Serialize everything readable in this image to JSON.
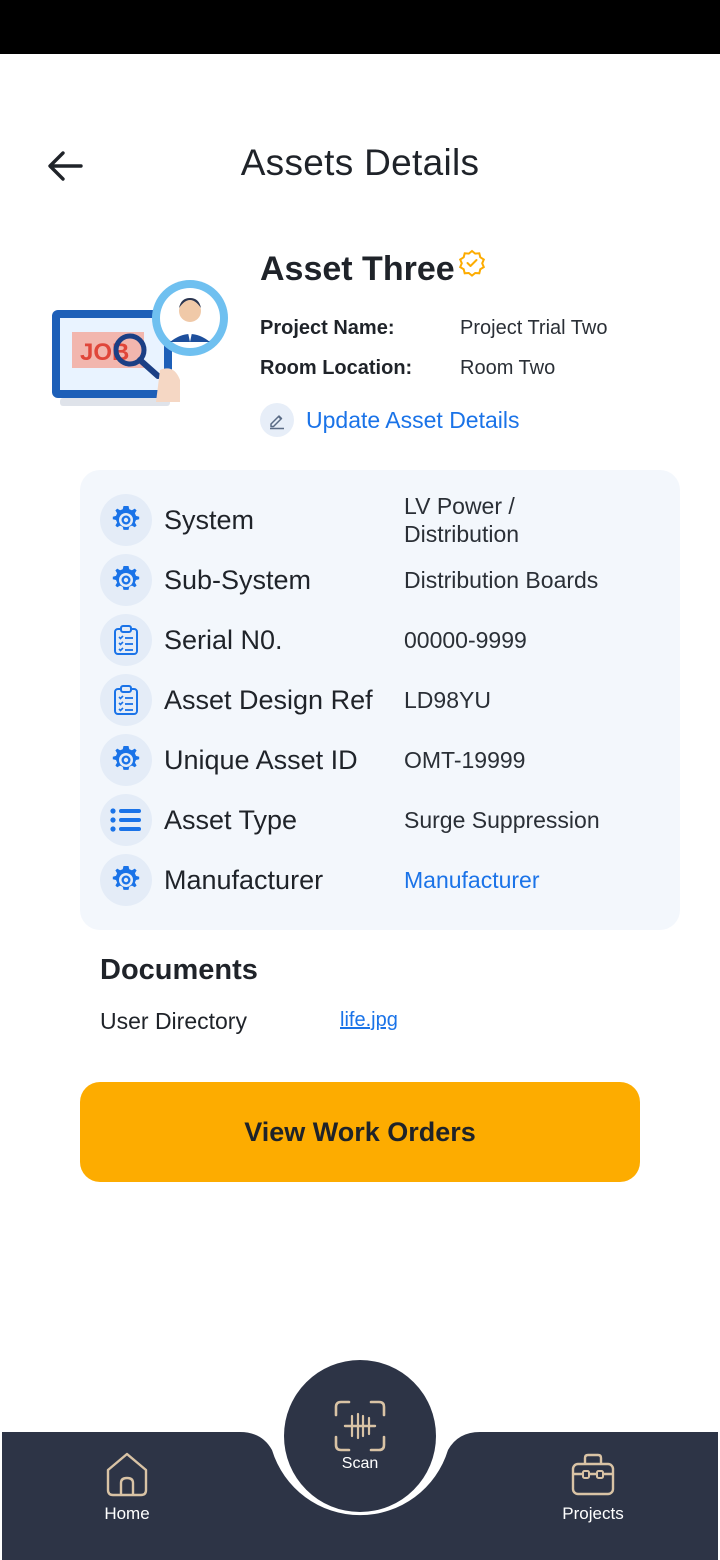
{
  "header": {
    "title": "Assets Details"
  },
  "asset": {
    "name": "Asset Three",
    "project_label": "Project Name:",
    "project_value": "Project Trial Two",
    "room_label": "Room Location:",
    "room_value": "Room Two",
    "update_link": "Update Asset Details",
    "illustration_text": "JOB"
  },
  "details": [
    {
      "label": "System",
      "value": "LV Power /\nDistribution",
      "icon": "gear-icon"
    },
    {
      "label": "Sub-System",
      "value": "Distribution Boards",
      "icon": "gear-icon"
    },
    {
      "label": "Serial N0.",
      "value": "00000-9999",
      "icon": "clipboard-icon"
    },
    {
      "label": "Asset Design Ref",
      "value": "LD98YU",
      "icon": "clipboard-icon"
    },
    {
      "label": "Unique Asset ID",
      "value": "OMT-19999",
      "icon": "gear-icon"
    },
    {
      "label": "Asset Type",
      "value": "Surge Suppression",
      "icon": "list-icon"
    },
    {
      "label": "Manufacturer",
      "value": "Manufacturer",
      "icon": "gear-icon"
    }
  ],
  "documents": {
    "title": "Documents",
    "label": "User Directory",
    "file": "life.jpg"
  },
  "actions": {
    "view_work_orders": "View Work Orders"
  },
  "nav": {
    "home": "Home",
    "scan": "Scan",
    "projects": "Projects"
  },
  "colors": {
    "accent": "#fdac00",
    "link": "#1a73e8",
    "nav_bg": "#2d3446",
    "card_bg": "#f3f7fc"
  }
}
